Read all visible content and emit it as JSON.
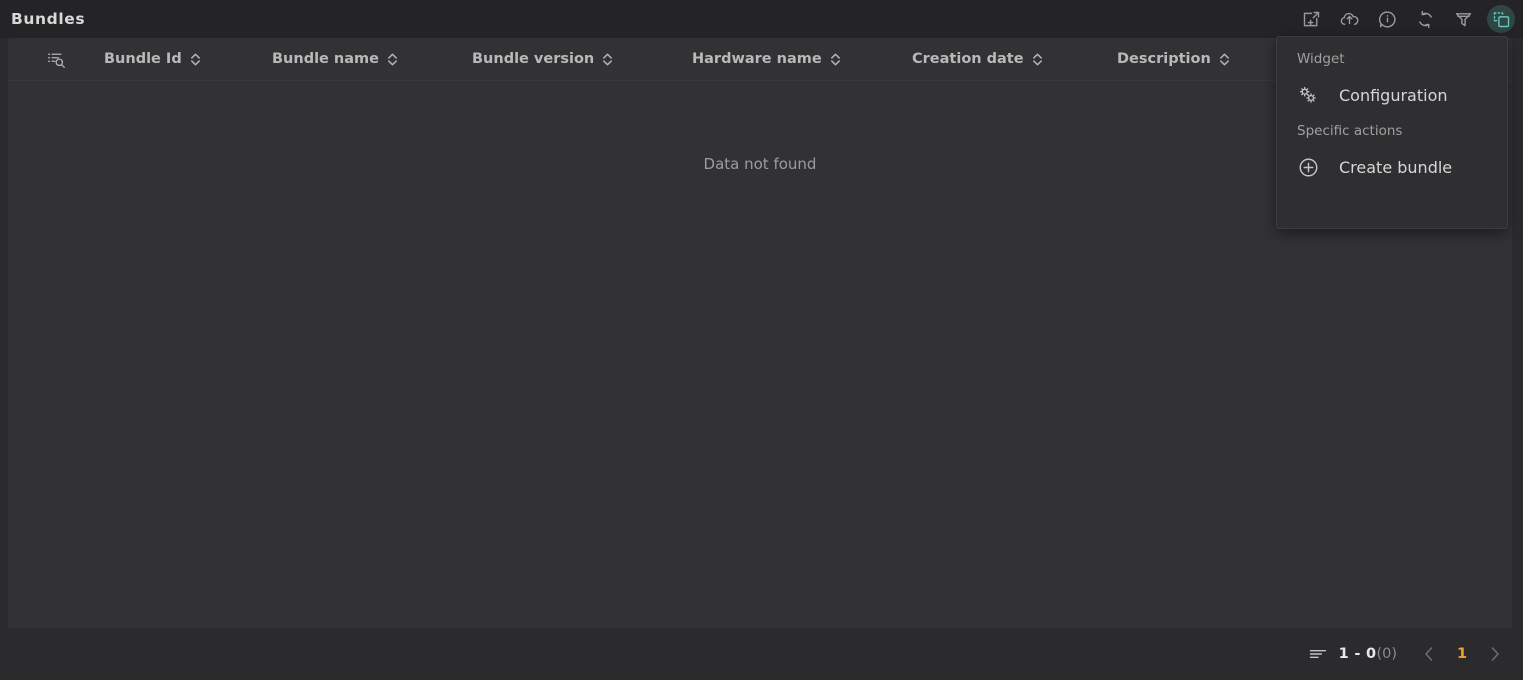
{
  "header": {
    "title": "Bundles",
    "toolbar": [
      {
        "name": "export-add-icon",
        "label": "Export"
      },
      {
        "name": "cloud-upload-icon",
        "label": "Upload"
      },
      {
        "name": "info-icon",
        "label": "Info"
      },
      {
        "name": "refresh-icon",
        "label": "Refresh"
      },
      {
        "name": "filter-icon",
        "label": "Filter"
      },
      {
        "name": "widget-icon",
        "label": "Widget",
        "active": true
      }
    ]
  },
  "table": {
    "search_icon": "list-search-icon",
    "columns": [
      {
        "label": "Bundle Id",
        "sortable": true
      },
      {
        "label": "Bundle name",
        "sortable": true
      },
      {
        "label": "Bundle version",
        "sortable": true
      },
      {
        "label": "Hardware name",
        "sortable": true
      },
      {
        "label": "Creation date",
        "sortable": true
      },
      {
        "label": "Description",
        "sortable": true
      }
    ],
    "rows": [],
    "empty_message": "Data not found"
  },
  "pagination": {
    "rows_icon": "rows-icon",
    "range": "1 - 0",
    "total": "(0)",
    "prev_label": "‹",
    "page": "1",
    "next_label": "›"
  },
  "widget_menu": {
    "section_widget": "Widget",
    "configuration_label": "Configuration",
    "section_specific": "Specific actions",
    "create_bundle_label": "Create bundle"
  },
  "colors": {
    "page_bg": "#2b2b2e",
    "topbar_bg": "#242427",
    "panel_bg": "#323235",
    "menu_bg": "#2f2f32",
    "accent_orange": "#f0a229",
    "accent_teal": "#6fc2bb",
    "text_primary": "#d8d8d8",
    "text_muted": "#9c9c9c"
  }
}
